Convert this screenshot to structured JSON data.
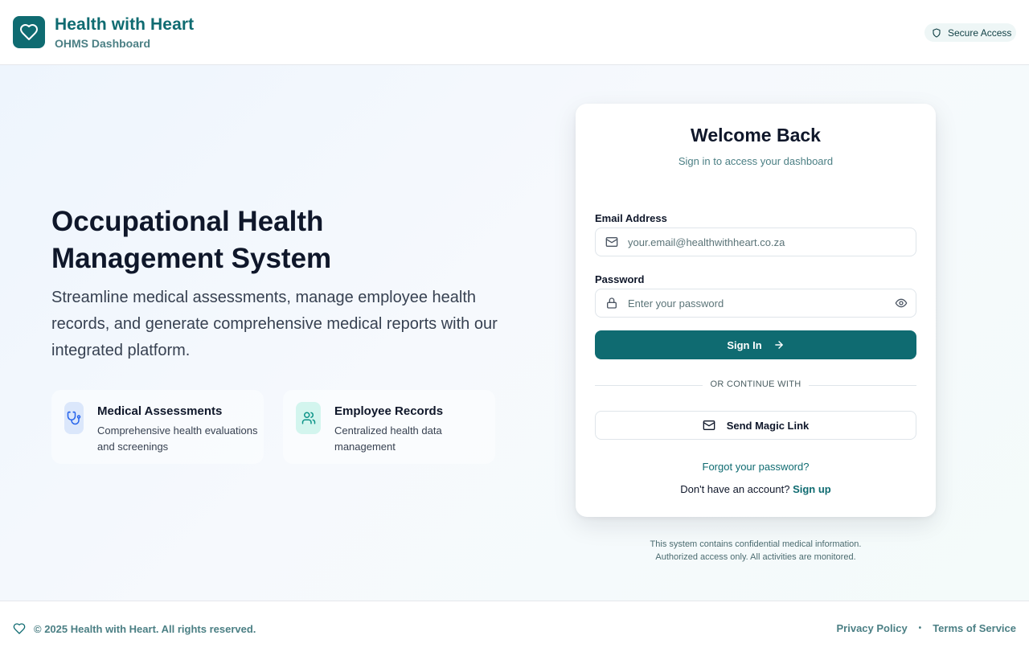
{
  "header": {
    "brand_title": "Health with Heart",
    "brand_subtitle": "OHMS Dashboard",
    "secure_badge": "Secure Access",
    "logo_icon": "heart-icon",
    "badge_icon": "shield-icon"
  },
  "hero": {
    "title": "Occupational Health Management System",
    "description": "Streamline medical assessments, manage employee health records, and generate comprehensive medical reports with our integrated platform.",
    "features": [
      {
        "icon": "stethoscope-icon",
        "title": "Medical Assessments",
        "description": "Comprehensive health evaluations and screenings"
      },
      {
        "icon": "users-icon",
        "title": "Employee Records",
        "description": "Centralized health data management"
      }
    ]
  },
  "login": {
    "title": "Welcome Back",
    "subtitle": "Sign in to access your dashboard",
    "email_label": "Email Address",
    "email_placeholder": "your.email@healthwithheart.co.za",
    "email_value": "",
    "password_label": "Password",
    "password_placeholder": "Enter your password",
    "password_value": "",
    "signin_label": "Sign In",
    "divider": "OR CONTINUE WITH",
    "magic_link_label": "Send Magic Link",
    "forgot": "Forgot your password?",
    "no_account": "Don't have an account?",
    "signup": "Sign up"
  },
  "notice": {
    "line1": "This system contains confidential medical information.",
    "line2": "Authorized access only. All activities are monitored."
  },
  "footer": {
    "copyright": "© 2025 Health with Heart. All rights reserved.",
    "privacy": "Privacy Policy",
    "separator": "•",
    "terms": "Terms of Service"
  },
  "colors": {
    "brand": "#0f6b71",
    "brand_muted": "#4b7f84",
    "text": "#0f172a"
  }
}
